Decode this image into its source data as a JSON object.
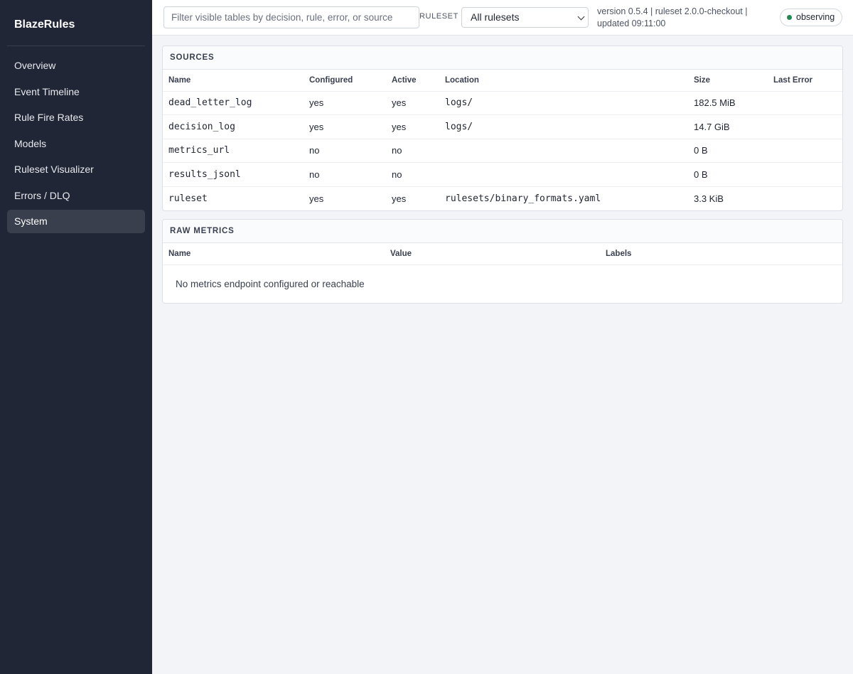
{
  "app": {
    "title": "BlazeRules"
  },
  "sidebar": {
    "items": [
      {
        "label": "Overview",
        "active": false
      },
      {
        "label": "Event Timeline",
        "active": false
      },
      {
        "label": "Rule Fire Rates",
        "active": false
      },
      {
        "label": "Models",
        "active": false
      },
      {
        "label": "Ruleset Visualizer",
        "active": false
      },
      {
        "label": "Errors / DLQ",
        "active": false
      },
      {
        "label": "System",
        "active": true
      }
    ]
  },
  "topbar": {
    "filter_placeholder": "Filter visible tables by decision, rule, error, or source",
    "filter_value": "",
    "ruleset_label": "RULESET",
    "ruleset_selected": "All rulesets",
    "meta_line1": "version 0.5.4 | ruleset 2.0.0-checkout |",
    "meta_line2": "updated 09:11:00",
    "status": "observing",
    "status_color": "#1e8a50"
  },
  "sources": {
    "title": "SOURCES",
    "columns": [
      "Name",
      "Configured",
      "Active",
      "Location",
      "Size",
      "Last Error"
    ],
    "rows": [
      {
        "name": "dead_letter_log",
        "configured": "yes",
        "active": "yes",
        "location": "logs/",
        "size": "182.5 MiB",
        "last_error": ""
      },
      {
        "name": "decision_log",
        "configured": "yes",
        "active": "yes",
        "location": "logs/",
        "size": "14.7 GiB",
        "last_error": ""
      },
      {
        "name": "metrics_url",
        "configured": "no",
        "active": "no",
        "location": "",
        "size": "0 B",
        "last_error": ""
      },
      {
        "name": "results_jsonl",
        "configured": "no",
        "active": "no",
        "location": "",
        "size": "0 B",
        "last_error": ""
      },
      {
        "name": "ruleset",
        "configured": "yes",
        "active": "yes",
        "location": "rulesets/binary_formats.yaml",
        "size": "3.3 KiB",
        "last_error": ""
      }
    ]
  },
  "raw_metrics": {
    "title": "RAW METRICS",
    "columns": [
      "Name",
      "Value",
      "Labels"
    ],
    "empty_message": "No metrics endpoint configured or reachable"
  }
}
